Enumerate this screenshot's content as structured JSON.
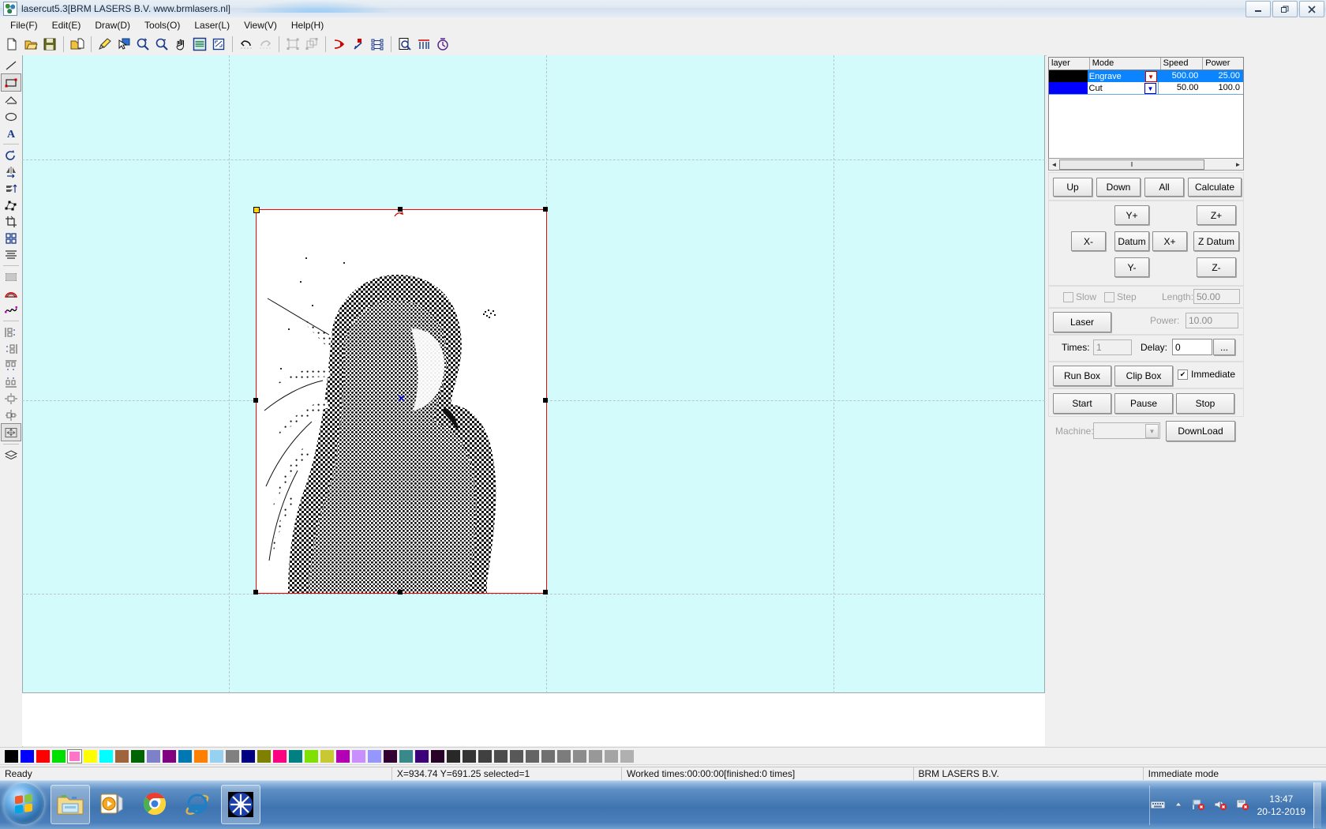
{
  "window": {
    "title": "lasercut5.3[BRM LASERS B.V. www.brmlasers.nl]",
    "app_icon": "lasercut-logo-icon",
    "minimize_label": "–",
    "restore_label": "❐",
    "close_label": "✖"
  },
  "menubar": {
    "items": [
      {
        "label": "File(F)"
      },
      {
        "label": "Edit(E)"
      },
      {
        "label": "Draw(D)"
      },
      {
        "label": "Tools(O)"
      },
      {
        "label": "Laser(L)"
      },
      {
        "label": "View(V)"
      },
      {
        "label": "Help(H)"
      }
    ]
  },
  "toolbar": {
    "items": [
      {
        "name": "new-file-icon",
        "tip": "New"
      },
      {
        "name": "open-file-icon",
        "tip": "Open"
      },
      {
        "name": "save-file-icon",
        "tip": "Save"
      },
      {
        "name": "separator"
      },
      {
        "name": "import-file-icon",
        "tip": "Import"
      },
      {
        "name": "separator"
      },
      {
        "name": "brush-icon",
        "tip": "Brush"
      },
      {
        "name": "select-arrow-icon",
        "tip": "Select"
      },
      {
        "name": "zoom-in-icon",
        "tip": "Zoom In"
      },
      {
        "name": "zoom-out-icon",
        "tip": "Zoom Out"
      },
      {
        "name": "pan-hand-icon",
        "tip": "Pan"
      },
      {
        "name": "zoom-page-icon",
        "tip": "Zoom Page"
      },
      {
        "name": "zoom-selection-icon",
        "tip": "Zoom Selection"
      },
      {
        "name": "separator"
      },
      {
        "name": "undo-icon",
        "tip": "Undo"
      },
      {
        "name": "redo-icon",
        "tip": "Redo"
      },
      {
        "name": "separator"
      },
      {
        "name": "group-icon",
        "tip": "Group"
      },
      {
        "name": "ungroup-icon",
        "tip": "Ungroup"
      },
      {
        "name": "separator"
      },
      {
        "name": "cut-direction-icon",
        "tip": "Cut Direction"
      },
      {
        "name": "start-point-icon",
        "tip": "Set Start Point"
      },
      {
        "name": "order-list-icon",
        "tip": "Cut Order"
      },
      {
        "name": "separator"
      },
      {
        "name": "preview-icon",
        "tip": "Preview"
      },
      {
        "name": "array-icon",
        "tip": "Array"
      },
      {
        "name": "estimate-time-icon",
        "tip": "Estimate Time"
      }
    ]
  },
  "left_tools": {
    "items": [
      {
        "name": "line-tool-icon",
        "selected": false
      },
      {
        "name": "rectangle-tool-icon",
        "selected": true
      },
      {
        "name": "polyline-tool-icon",
        "selected": false
      },
      {
        "name": "ellipse-tool-icon",
        "selected": false
      },
      {
        "name": "text-tool-icon",
        "selected": false
      },
      {
        "name": "separator"
      },
      {
        "name": "rotate-tool-icon",
        "selected": false
      },
      {
        "name": "mirror-horizontal-icon",
        "selected": false
      },
      {
        "name": "mirror-vertical-icon",
        "selected": false
      },
      {
        "name": "node-edit-icon",
        "selected": false
      },
      {
        "name": "crop-icon",
        "selected": false
      },
      {
        "name": "array-copy-icon",
        "selected": false
      },
      {
        "name": "align-text-icon",
        "selected": false
      },
      {
        "name": "separator"
      },
      {
        "name": "bitmap-icon",
        "selected": false
      },
      {
        "name": "offset-icon",
        "selected": false
      },
      {
        "name": "curve-smooth-icon",
        "selected": false
      },
      {
        "name": "separator"
      },
      {
        "name": "align-left-icon",
        "selected": false
      },
      {
        "name": "align-right-icon",
        "selected": false
      },
      {
        "name": "align-top-icon",
        "selected": false
      },
      {
        "name": "align-bottom-icon",
        "selected": false
      },
      {
        "name": "align-center-vertical-icon",
        "selected": false
      },
      {
        "name": "align-center-horizontal-icon",
        "selected": false
      },
      {
        "name": "align-center-both-icon",
        "selected": true
      },
      {
        "name": "separator"
      },
      {
        "name": "layers-icon",
        "selected": false
      }
    ]
  },
  "layer_table": {
    "columns": [
      "layer",
      "Mode",
      "Speed",
      "Power"
    ],
    "rows": [
      {
        "color": "#000000",
        "mode": "Engrave",
        "speed": "500.00",
        "power": "25.00",
        "selected": true,
        "dropdown_color": "#cc0000"
      },
      {
        "color": "#0000ff",
        "mode": "Cut",
        "speed": "50.00",
        "power": "100.0",
        "selected": false,
        "dropdown_color": "#0000cc"
      }
    ],
    "scroll_left_arrow": "◄",
    "scroll_right_arrow": "►",
    "scroll_grip": "‖"
  },
  "layer_buttons": {
    "up": "Up",
    "down": "Down",
    "all": "All",
    "calculate": "Calculate"
  },
  "jog": {
    "y_plus": "Y+",
    "y_minus": "Y-",
    "x_plus": "X+",
    "x_minus": "X-",
    "datum": "Datum",
    "z_plus": "Z+",
    "z_minus": "Z-",
    "z_datum": "Z Datum"
  },
  "jog_options": {
    "slow_label": "Slow",
    "slow_checked": false,
    "step_label": "Step",
    "step_checked": false,
    "length_label": "Length:",
    "length_value": "50.00"
  },
  "laser_row": {
    "laser_button": "Laser",
    "power_label": "Power:",
    "power_value": "10.00"
  },
  "times_row": {
    "times_label": "Times:",
    "times_value": "1",
    "delay_label": "Delay:",
    "delay_value": "0",
    "more_button": "..."
  },
  "box_row": {
    "run_box": "Run Box",
    "clip_box": "Clip Box",
    "immediate_label": "Immediate",
    "immediate_checked": true,
    "check_glyph": "✔"
  },
  "run_row": {
    "start": "Start",
    "pause": "Pause",
    "stop": "Stop"
  },
  "machine_row": {
    "machine_label": "Machine:",
    "machine_value": "",
    "download": "DownLoad",
    "dropdown_glyph": "▼"
  },
  "canvas": {
    "background_color": "#d4fbfb",
    "page_color": "#ffffff",
    "selection_color": "#ff0000",
    "origin_handle_color": "#ffd400",
    "cursor_marker": "✕",
    "cursor_marker_color": "#0000cc"
  },
  "palette": {
    "colors": [
      "#000000",
      "#0000ff",
      "#ff0000",
      "#00e000",
      "#ff74c8",
      "#ffff00",
      "#00ffff",
      "#a0643c",
      "#006400",
      "#8080c8",
      "#800080",
      "#0078b4",
      "#ff8000",
      "#96d2f0",
      "#808080",
      "#000080",
      "#808000",
      "#ff0080",
      "#008080",
      "#80e000",
      "#c8c832",
      "#b400b4",
      "#c890ff",
      "#9696ff",
      "#320032",
      "#38888c",
      "#3c0078",
      "#280028",
      "#282828",
      "#343434",
      "#404040",
      "#4c4c4c",
      "#585858",
      "#646464",
      "#707070",
      "#7c7c7c",
      "#8c8c8c",
      "#989898",
      "#a4a4a4",
      "#b0b0b0"
    ],
    "selected_index": 4
  },
  "statusbar": {
    "ready": "Ready",
    "coords": "X=934.74 Y=691.25 selected=1",
    "worked": "Worked times:00:00:00[finished:0 times]",
    "company": "BRM LASERS B.V.",
    "mode": "Immediate mode"
  },
  "taskbar": {
    "start_icon": "windows-start-orb-icon",
    "apps": [
      {
        "name": "file-explorer-icon",
        "active": true
      },
      {
        "name": "media-player-icon",
        "active": false
      },
      {
        "name": "google-chrome-icon",
        "active": false
      },
      {
        "name": "internet-explorer-icon",
        "active": false
      },
      {
        "name": "lasercut-app-icon",
        "active": true
      }
    ],
    "tray": [
      {
        "name": "keyboard-language-icon"
      },
      {
        "name": "show-hidden-icons-icon"
      },
      {
        "name": "network-disconnected-icon"
      },
      {
        "name": "volume-muted-icon"
      },
      {
        "name": "safely-remove-hardware-icon"
      }
    ],
    "clock_time": "13:47",
    "clock_date": "20-12-2019"
  }
}
